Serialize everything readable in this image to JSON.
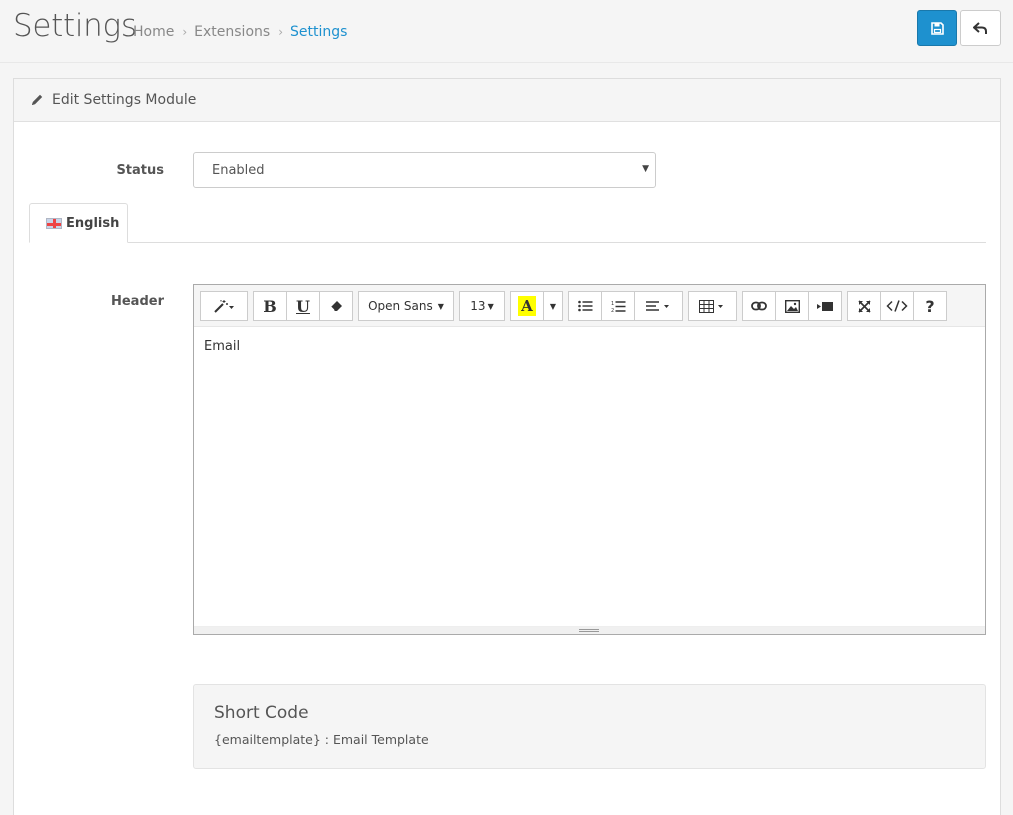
{
  "header": {
    "title": "Settings",
    "breadcrumb": [
      "Home",
      "Extensions",
      "Settings"
    ],
    "save_icon": "floppy-icon",
    "back_icon": "reply-icon"
  },
  "panel": {
    "title": "Edit Settings Module",
    "icon": "pencil-icon"
  },
  "form": {
    "status_label": "Status",
    "status_value": "Enabled",
    "header_label": "Header"
  },
  "tabs": [
    {
      "label": "English",
      "icon": "flag-uk-icon",
      "active": true
    }
  ],
  "editor": {
    "font_name": "Open Sans",
    "font_size": "13",
    "color_letter": "A",
    "content": "Email",
    "toolbar_icons": [
      "magic-wand-icon",
      "bold-icon",
      "underline-icon",
      "eraser-icon",
      "font-family-dropdown",
      "font-size-dropdown",
      "highlight-color-icon",
      "color-dropdown-caret",
      "unordered-list-icon",
      "ordered-list-icon",
      "align-icon",
      "table-icon",
      "link-icon",
      "picture-icon",
      "video-icon",
      "fullscreen-icon",
      "code-view-icon",
      "help-icon"
    ]
  },
  "shortcode": {
    "title": "Short Code",
    "text": "{emailtemplate} : Email Template"
  },
  "colors": {
    "primary": "#1e91cf",
    "highlight": "#ffff00"
  }
}
